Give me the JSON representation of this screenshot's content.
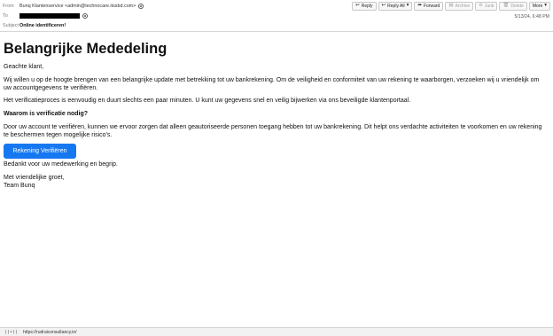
{
  "header": {
    "from_label": "From",
    "from_value": "Bunq Klantenservice <admin@technocare.itssbd.com>",
    "to_label": "To",
    "subject_label": "Subject",
    "subject_value": "Online identificeren!",
    "date": "5/13/24, 6:48 PM"
  },
  "toolbar": {
    "reply": "Reply",
    "reply_all": "Reply All",
    "forward": "Forward",
    "archive": "Archive",
    "junk": "Junk",
    "delete": "Delete",
    "more": "More"
  },
  "email": {
    "title": "Belangrijke Mededeling",
    "greeting": "Geachte klant,",
    "p1": "Wij willen u op de hoogte brengen van een belangrijke update met betrekking tot uw bankrekening. Om de veiligheid en conformiteit van uw rekening te waarborgen, verzoeken wij u vriendelijk om uw accountgegevens te verifiëren.",
    "p2": "Het verificatieproces is eenvoudig en duurt slechts een paar minuten. U kunt uw gegevens snel en veilig bijwerken via ons beveiligde klantenportaal.",
    "heading": "Waarom is verificatie nodig?",
    "p3": "Door uw account te verifiëren, kunnen we ervoor zorgen dat alleen geautoriseerde personen toegang hebben tot uw bankrekening. Dit helpt ons verdachte activiteiten te voorkomen en uw rekening te beschermen tegen mogelijke risico's.",
    "button": "Rekening Verifiëren",
    "p4": "Bedankt voor uw medewerking en begrip.",
    "closing": "Met vriendelijke groet,",
    "signature": "Team Bunq"
  },
  "statusbar": {
    "icon_text": "((•))",
    "url": "https://rudraiconsultancy.in/"
  },
  "colors": {
    "button_bg": "#1678f1"
  }
}
